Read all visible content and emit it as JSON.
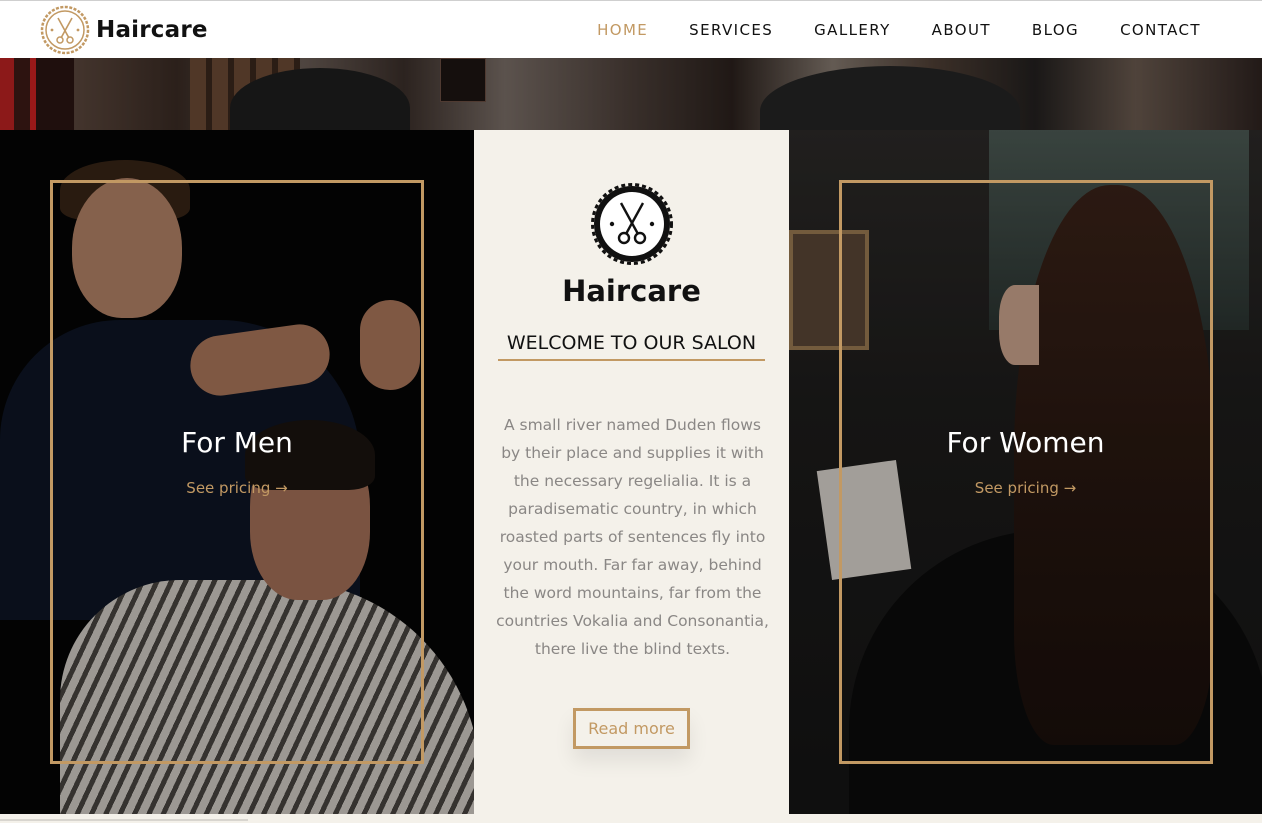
{
  "brand": {
    "name": "Haircare",
    "logo_icon": "scissors-badge-icon",
    "accent": "#c29963"
  },
  "nav": {
    "items": [
      {
        "label": "HOME",
        "active": true
      },
      {
        "label": "SERVICES",
        "active": false
      },
      {
        "label": "GALLERY",
        "active": false
      },
      {
        "label": "ABOUT",
        "active": false
      },
      {
        "label": "BLOG",
        "active": false
      },
      {
        "label": "CONTACT",
        "active": false
      }
    ]
  },
  "men": {
    "title": "For Men",
    "link": "See pricing →"
  },
  "women": {
    "title": "For Women",
    "link": "See pricing →"
  },
  "center": {
    "brand": "Haircare",
    "welcome": "WELCOME TO OUR SALON",
    "body": "A small river named Duden flows by their place and supplies it with the necessary regelialia. It is a paradisematic country, in which roasted parts of sentences fly into your mouth. Far far away, behind the word mountains, far from the countries Vokalia and Consonantia, there live the blind texts.",
    "button": "Read more"
  }
}
